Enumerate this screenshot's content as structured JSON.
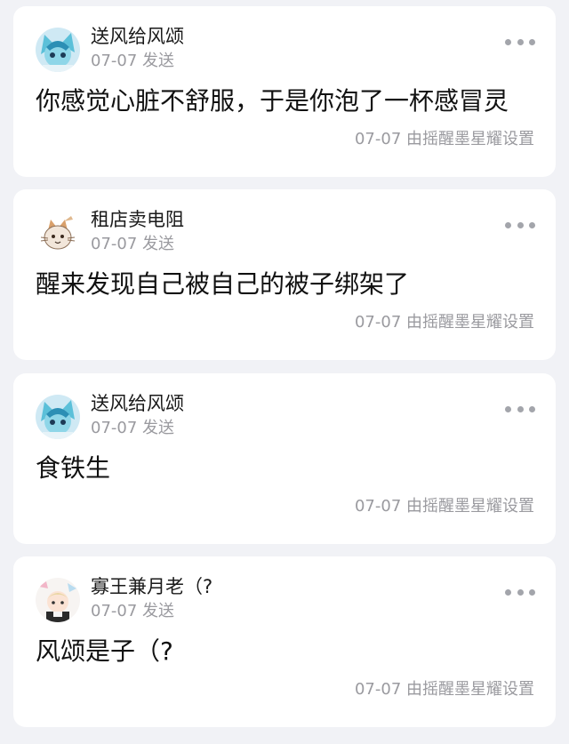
{
  "posts": [
    {
      "author": "送风给风颂",
      "meta": "07-07 发送",
      "content": "你感觉心脏不舒服，于是你泡了一杯感冒灵",
      "footer": "07-07 由摇醒墨星耀设置",
      "avatar_icon": "glaceon-avatar-icon"
    },
    {
      "author": "租店卖电阻",
      "meta": "07-07 发送",
      "content": "醒来发现自己被自己的被子绑架了",
      "footer": "07-07 由摇醒墨星耀设置",
      "avatar_icon": "cat-avatar-icon"
    },
    {
      "author": "送风给风颂",
      "meta": "07-07 发送",
      "content": "食铁生",
      "footer": "07-07 由摇醒墨星耀设置",
      "avatar_icon": "glaceon-avatar-icon"
    },
    {
      "author": "寡王兼月老（?",
      "meta": "07-07 发送",
      "content": "风颂是子（?",
      "footer": "07-07 由摇醒墨星耀设置",
      "avatar_icon": "anime-avatar-icon"
    }
  ],
  "colors": {
    "background": "#f1f2f6",
    "card": "#ffffff",
    "text": "#111111",
    "muted": "#9a9a9f"
  }
}
